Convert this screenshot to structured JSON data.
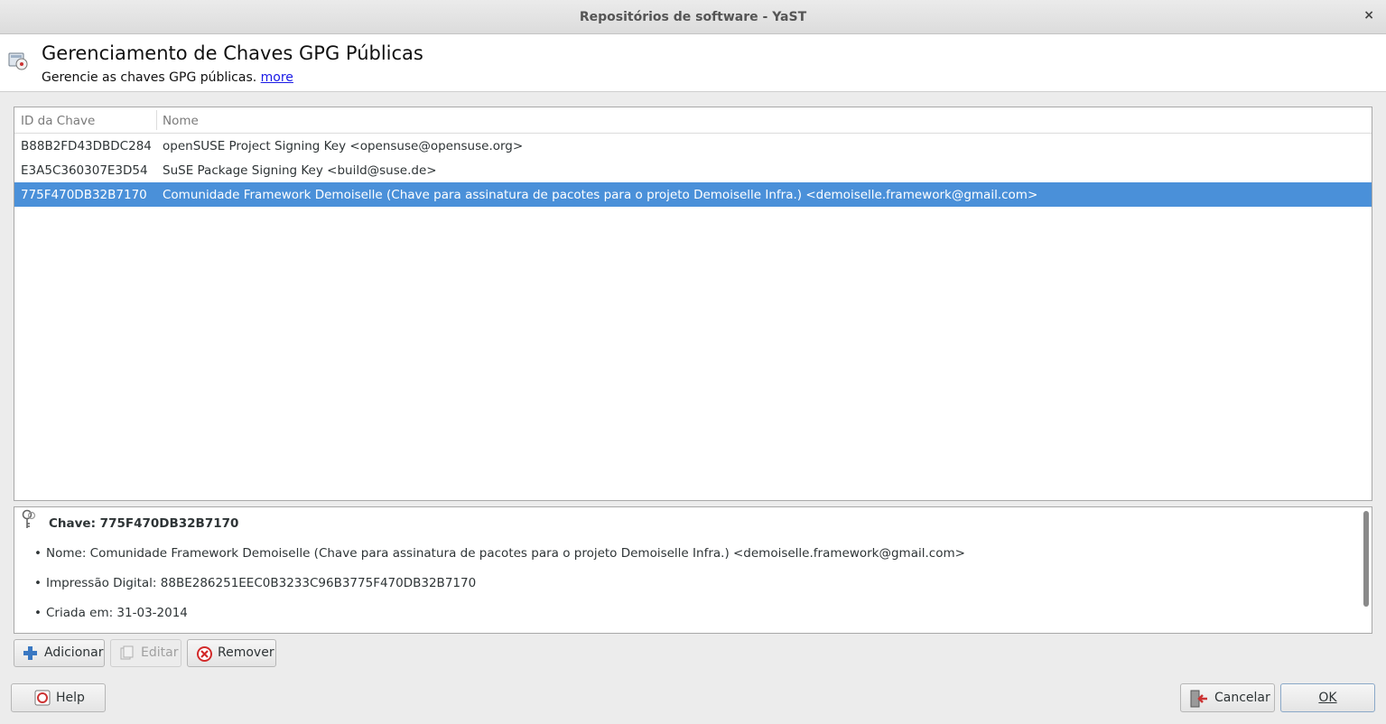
{
  "window": {
    "title": "Repositórios de software - YaST",
    "close_glyph": "×"
  },
  "header": {
    "title": "Gerenciamento de Chaves GPG Públicas",
    "subtitle": "Gerencie as chaves GPG públicas.",
    "more_link": "more",
    "icon": "software-repo-icon"
  },
  "table": {
    "columns": [
      "ID da Chave",
      "Nome"
    ],
    "rows": [
      {
        "id": "B88B2FD43DBDC284",
        "name": "openSUSE Project Signing Key <opensuse@opensuse.org>"
      },
      {
        "id": "E3A5C360307E3D54",
        "name": "SuSE Package Signing Key <build@suse.de>"
      },
      {
        "id": "775F470DB32B7170",
        "name": "Comunidade Framework Demoiselle (Chave para assinatura de pacotes para o projeto Demoiselle Infra.) <demoiselle.framework@gmail.com>"
      }
    ],
    "selected_index": 2
  },
  "details": {
    "title": "Chave: 775F470DB32B7170",
    "items": [
      "Nome: Comunidade Framework Demoiselle (Chave para assinatura de pacotes para o projeto Demoiselle Infra.) <demoiselle.framework@gmail.com>",
      "Impressão Digital: 88BE286251EEC0B3233C96B3775F470DB32B7170",
      "Criada em: 31-03-2014"
    ],
    "bullet": "•"
  },
  "buttons": {
    "add": "Adicionar",
    "edit": "Editar",
    "remove": "Remover",
    "help": "Help",
    "cancel": "Cancelar",
    "ok": "OK"
  },
  "colors": {
    "selection": "#4a90d9",
    "link": "#1a1ae6",
    "remove_icon": "#d22a2a",
    "add_icon": "#3a78c2"
  }
}
